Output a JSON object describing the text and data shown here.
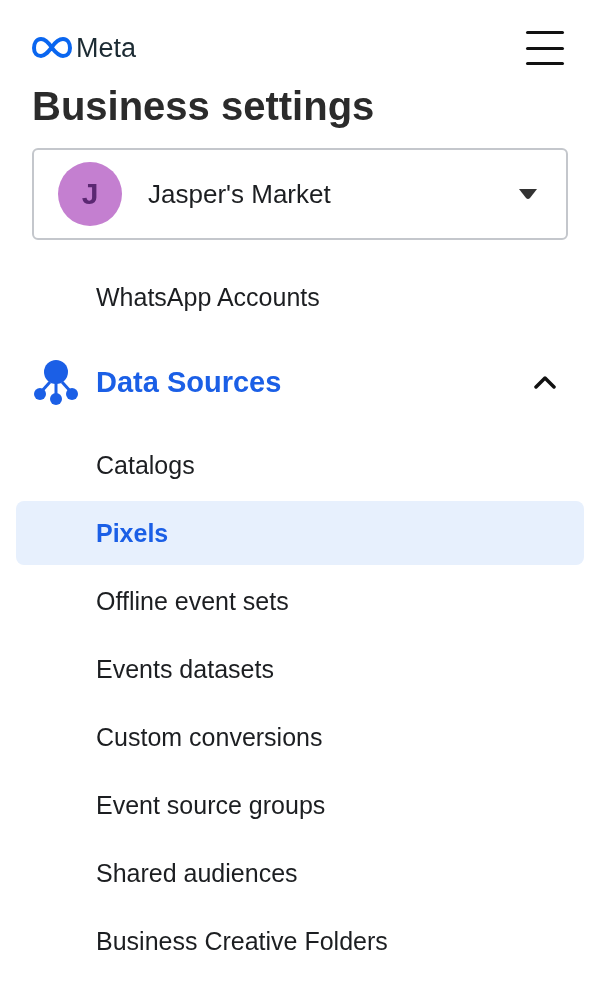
{
  "header": {
    "logo_text": "Meta"
  },
  "title": "Business settings",
  "account": {
    "initial": "J",
    "name": "Jasper's Market"
  },
  "items_above": [
    {
      "label": "WhatsApp Accounts",
      "selected": false
    }
  ],
  "section": {
    "label": "Data Sources",
    "expanded": true,
    "children": [
      {
        "label": "Catalogs",
        "selected": false
      },
      {
        "label": "Pixels",
        "selected": true
      },
      {
        "label": "Offline event sets",
        "selected": false
      },
      {
        "label": "Events datasets",
        "selected": false
      },
      {
        "label": "Custom conversions",
        "selected": false
      },
      {
        "label": "Event source groups",
        "selected": false
      },
      {
        "label": "Shared audiences",
        "selected": false
      },
      {
        "label": "Business Creative Folders",
        "selected": false
      }
    ]
  }
}
